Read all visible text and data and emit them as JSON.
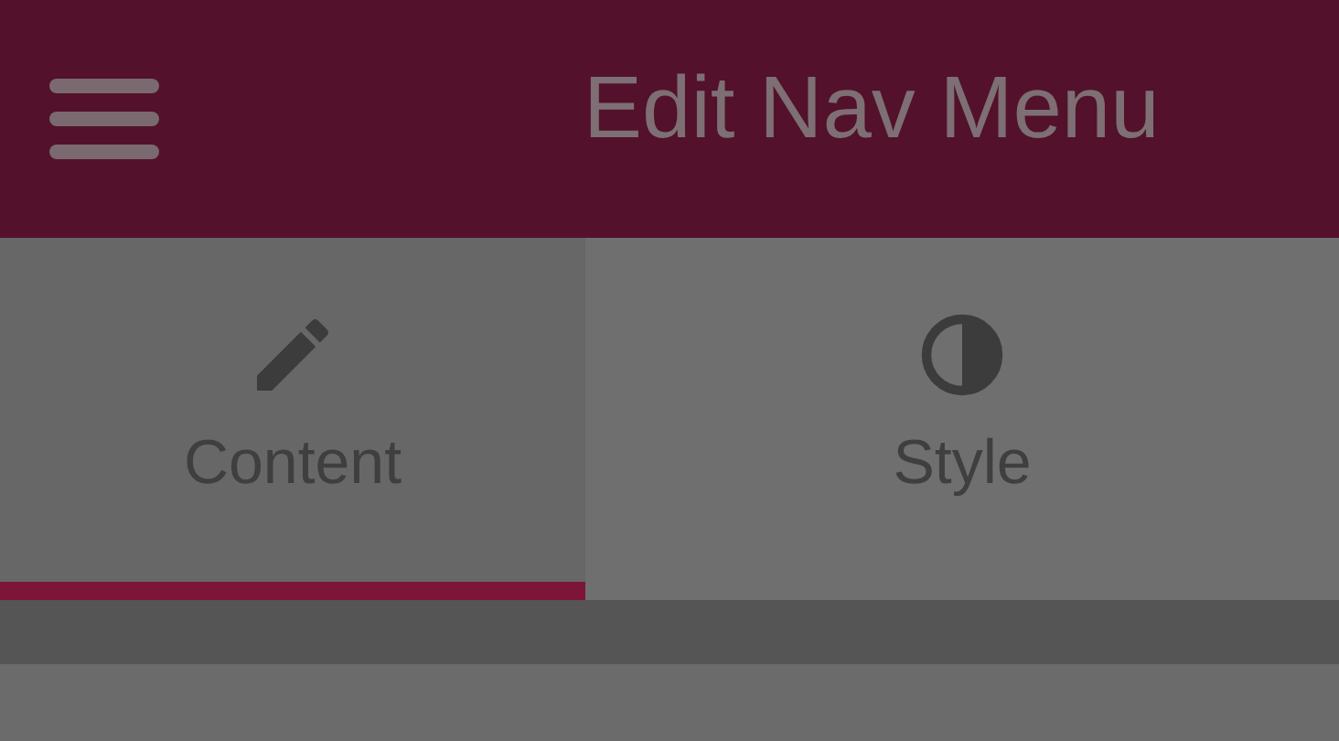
{
  "header": {
    "title": "Edit Nav Menu"
  },
  "tabs": [
    {
      "label": "Content",
      "kind": "pencil",
      "selected": true
    },
    {
      "label": "Style",
      "kind": "contrast",
      "selected": false
    }
  ]
}
